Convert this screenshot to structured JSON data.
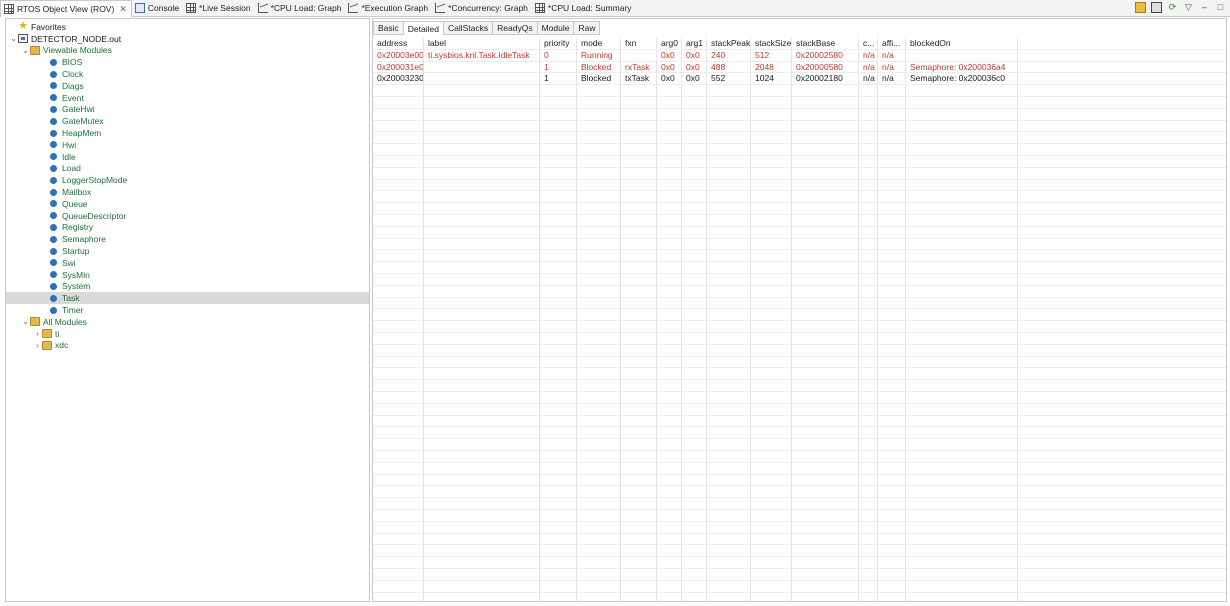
{
  "view_tabs": [
    {
      "label": "RTOS Object View (ROV)",
      "icon": "grid-icon",
      "active": true,
      "closable": true
    },
    {
      "label": "Console",
      "icon": "console-icon"
    },
    {
      "label": "*Live Session",
      "icon": "grid-icon"
    },
    {
      "label": "*CPU Load: Graph",
      "icon": "chart-icon"
    },
    {
      "label": "*Execution Graph",
      "icon": "chart-icon"
    },
    {
      "label": "*Concurrency: Graph",
      "icon": "chart-icon"
    },
    {
      "label": "*CPU Load: Summary",
      "icon": "grid-icon"
    }
  ],
  "close_glyph": "✕",
  "tree": {
    "favorites": "Favorites",
    "root": "DETECTOR_NODE.out",
    "viewable_modules": "Viewable Modules",
    "modules": [
      "BIOS",
      "Clock",
      "Diags",
      "Event",
      "GateHwi",
      "GateMutex",
      "HeapMem",
      "Hwi",
      "Idle",
      "Load",
      "LoggerStopMode",
      "Mailbox",
      "Queue",
      "QueueDescriptor",
      "Registry",
      "Semaphore",
      "Startup",
      "Swi",
      "SysMin",
      "System",
      "Task",
      "Timer"
    ],
    "selected_module": "Task",
    "all_modules": "All Modules",
    "all_children": [
      "ti",
      "xdc"
    ]
  },
  "subtabs": [
    {
      "label": "Basic"
    },
    {
      "label": "Detailed",
      "active": true
    },
    {
      "label": "CallStacks"
    },
    {
      "label": "ReadyQs"
    },
    {
      "label": "Module"
    },
    {
      "label": "Raw"
    }
  ],
  "table": {
    "columns": [
      "address",
      "label",
      "priority",
      "mode",
      "fxn",
      "arg0",
      "arg1",
      "stackPeak",
      "stackSize",
      "stackBase",
      "c...",
      "affi...",
      "blockedOn"
    ],
    "rows": [
      {
        "highlight": true,
        "cells": [
          "0x20003e00",
          "ti.sysbios.knl.Task.IdleTask",
          "0",
          "Running",
          "",
          "0x0",
          "0x0",
          "240",
          "512",
          "0x20002580",
          "n/a",
          "n/a",
          ""
        ]
      },
      {
        "highlight": true,
        "cells": [
          "0x200031e0",
          "",
          "1",
          "Blocked",
          "rxTask",
          "0x0",
          "0x0",
          "488",
          "2048",
          "0x20000580",
          "n/a",
          "n/a",
          "Semaphore: 0x200036a4"
        ]
      },
      {
        "highlight": false,
        "cells": [
          "0x20003230",
          "",
          "1",
          "Blocked",
          "txTask",
          "0x0",
          "0x0",
          "552",
          "1024",
          "0x20002180",
          "n/a",
          "n/a",
          "Semaphore: 0x200036c0"
        ]
      }
    ]
  },
  "colors": {
    "highlight_text": "#c0392b",
    "module_text": "#1e6f3a",
    "module_icon": "#2e6fb8"
  }
}
